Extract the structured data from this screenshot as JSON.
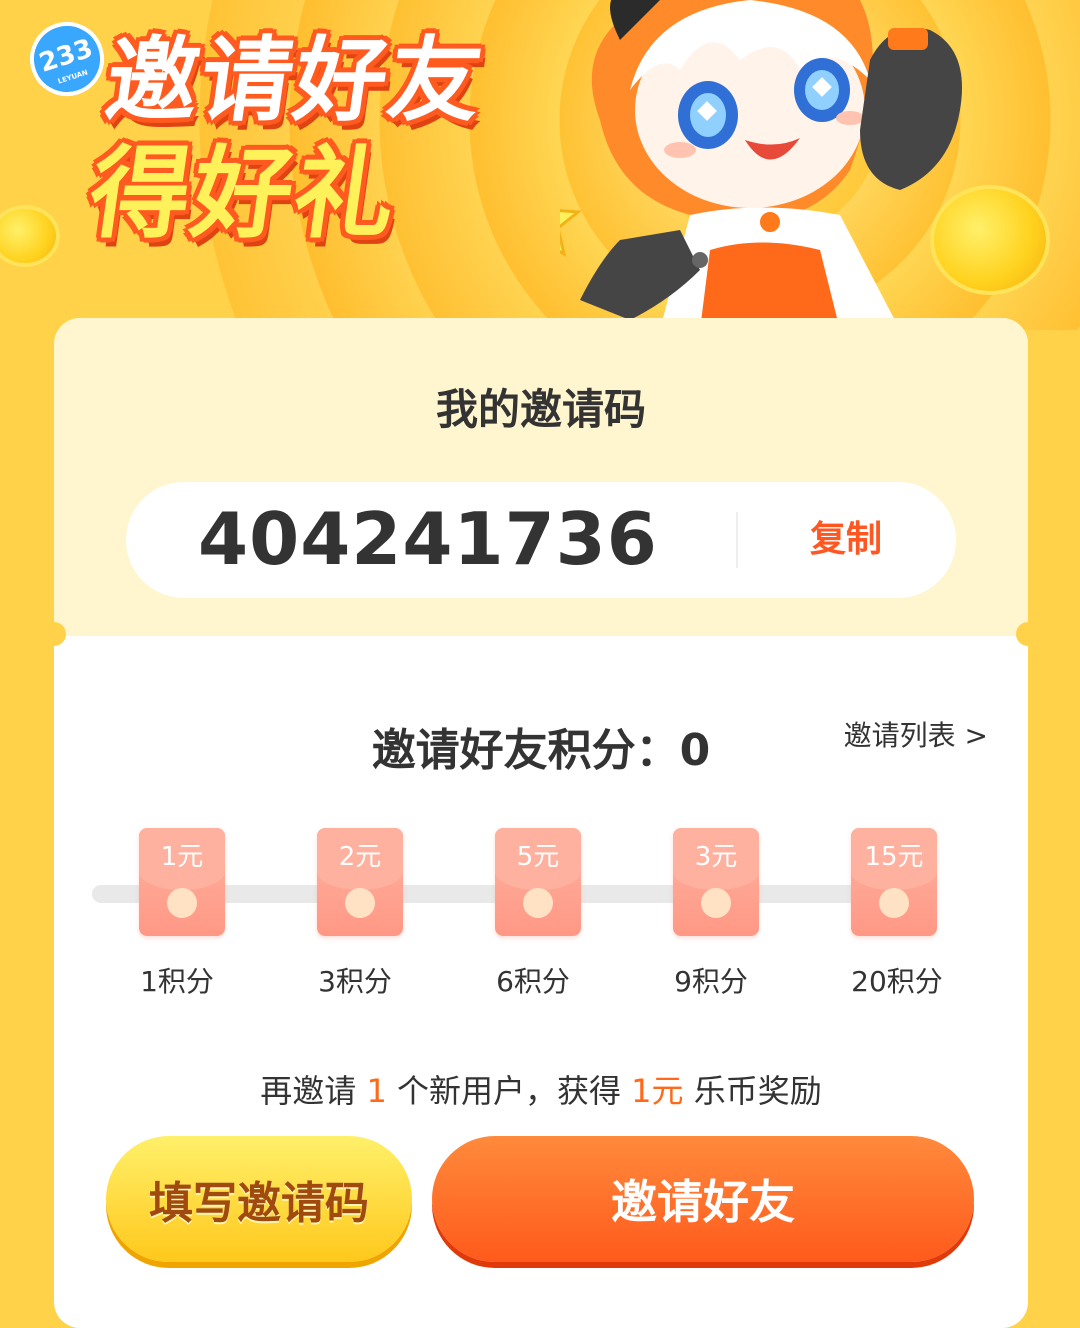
{
  "banner": {
    "logo_text": "233",
    "logo_sub": "LEYUAN",
    "title_line1": "邀请好友",
    "title_line2": "得好礼"
  },
  "code_section": {
    "title": "我的邀请码",
    "code": "404241736",
    "copy_label": "复制"
  },
  "points_section": {
    "label": "邀请好友积分：0",
    "invite_list_link": "邀请列表 >",
    "rewards": [
      {
        "amount": "1元",
        "points": "1积分"
      },
      {
        "amount": "2元",
        "points": "3积分"
      },
      {
        "amount": "5元",
        "points": "6积分"
      },
      {
        "amount": "3元",
        "points": "9积分"
      },
      {
        "amount": "15元",
        "points": "20积分"
      }
    ],
    "hint_prefix": "再邀请 ",
    "hint_count": "1",
    "hint_middle": " 个新用户，获得 ",
    "hint_reward": "1元",
    "hint_suffix": " 乐币奖励"
  },
  "buttons": {
    "fill_code": "填写邀请码",
    "invite": "邀请好友"
  },
  "colors": {
    "accent": "#ff5722",
    "background": "#ffd24a"
  }
}
